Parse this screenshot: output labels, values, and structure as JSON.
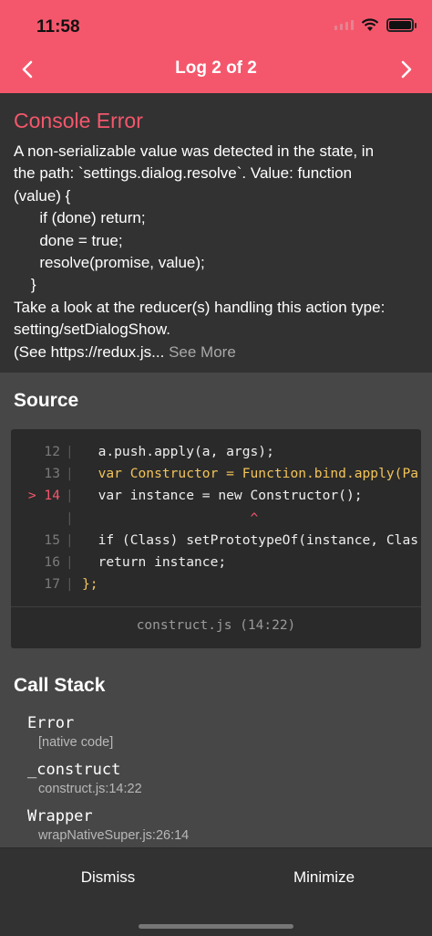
{
  "status_bar": {
    "time": "11:58"
  },
  "header": {
    "title": "Log 2 of 2",
    "prev_icon": "chevron-left-icon",
    "next_icon": "chevron-right-icon"
  },
  "message": {
    "title": "Console Error",
    "body": "A non-serializable value was detected in the state, in\nthe path: `settings.dialog.resolve`. Value: function\n(value) {\n      if (done) return;\n      done = true;\n      resolve(promise, value);\n    }\nTake a look at the reducer(s) handling this action type:\nsetting/setDialogShow.\n(See https://redux.js...",
    "see_more": " See More"
  },
  "source": {
    "title": "Source",
    "file": "construct.js (14:22)",
    "lines": [
      {
        "gutter": "12",
        "marker": ""
      },
      {
        "gutter": "13",
        "marker": ""
      },
      {
        "gutter": "14",
        "marker": ">"
      },
      {
        "gutter": "",
        "marker": ""
      },
      {
        "gutter": "15",
        "marker": ""
      },
      {
        "gutter": "16",
        "marker": ""
      },
      {
        "gutter": "17",
        "marker": ""
      }
    ],
    "code": [
      "  a.push.apply(a, args);",
      "  var Constructor = Function.bind.apply(Pa",
      "  var instance = new Constructor();",
      "                     ^",
      "  if (Class) setPrototypeOf(instance, Clas",
      "  return instance;",
      "};"
    ]
  },
  "call_stack": {
    "title": "Call Stack",
    "frames": [
      {
        "name": "Error",
        "location": "[native code]"
      },
      {
        "name": "_construct",
        "location": "construct.js:14:22"
      },
      {
        "name": "Wrapper",
        "location": "wrapNativeSuper.js:26:14"
      }
    ]
  },
  "footer": {
    "dismiss": "Dismiss",
    "minimize": "Minimize"
  },
  "colors": {
    "accent": "#f4576c",
    "keyword": "#f3c45a",
    "panel": "#323232",
    "background": "#474747"
  }
}
